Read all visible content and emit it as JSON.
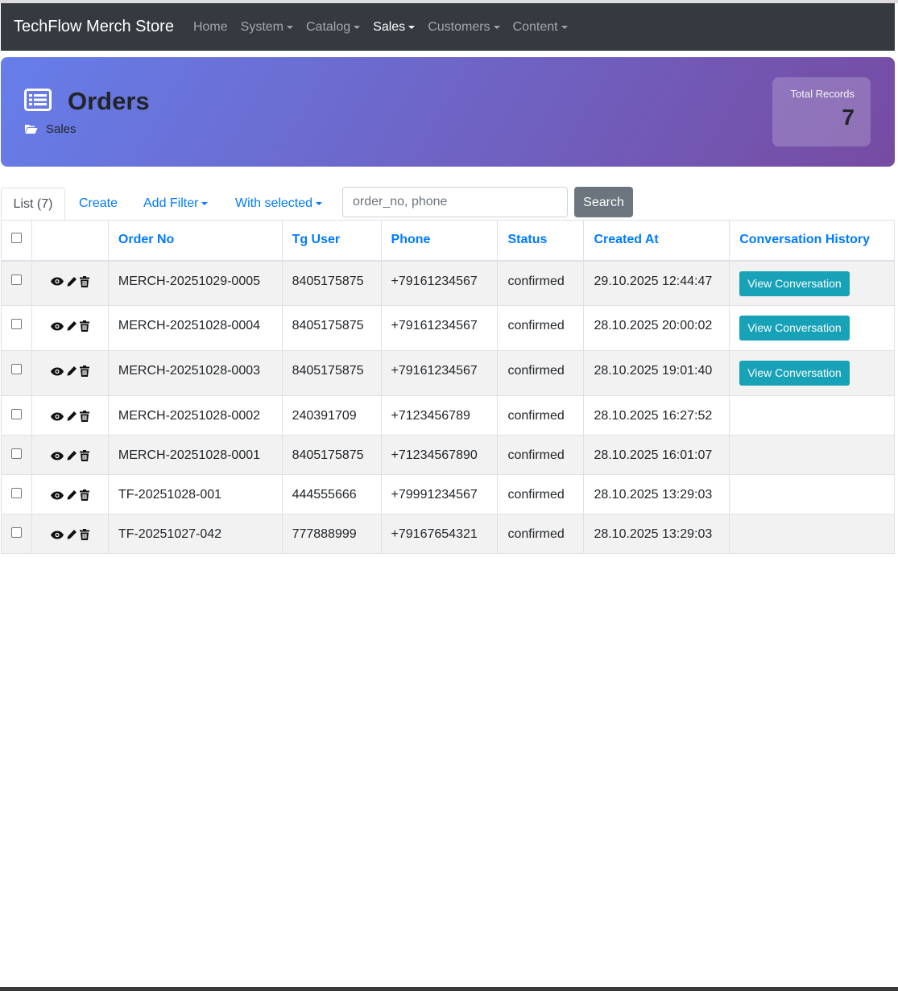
{
  "navbar": {
    "brand": "TechFlow Merch Store",
    "items": [
      {
        "label": "Home",
        "dropdown": false,
        "active": false
      },
      {
        "label": "System",
        "dropdown": true,
        "active": false
      },
      {
        "label": "Catalog",
        "dropdown": true,
        "active": false
      },
      {
        "label": "Sales",
        "dropdown": true,
        "active": true
      },
      {
        "label": "Customers",
        "dropdown": true,
        "active": false
      },
      {
        "label": "Content",
        "dropdown": true,
        "active": false
      }
    ]
  },
  "header": {
    "title": "Orders",
    "breadcrumb": "Sales",
    "total_records_label": "Total Records",
    "total_records_value": "7",
    "gradient_start": "#667eea",
    "gradient_end": "#764ba2"
  },
  "toolbar": {
    "list_tab": "List (7)",
    "create": "Create",
    "add_filter": "Add Filter",
    "with_selected": "With selected",
    "search_placeholder": "order_no, phone",
    "search_button": "Search"
  },
  "table": {
    "columns": [
      "Order No",
      "Tg User",
      "Phone",
      "Status",
      "Created At",
      "Conversation History"
    ],
    "view_conversation_label": "View Conversation",
    "rows": [
      {
        "order_no": "MERCH-20251029-0005",
        "tg_user": "8405175875",
        "phone": "+79161234567",
        "status": "confirmed",
        "created_at": "29.10.2025 12:44:47",
        "has_conversation": true
      },
      {
        "order_no": "MERCH-20251028-0004",
        "tg_user": "8405175875",
        "phone": "+79161234567",
        "status": "confirmed",
        "created_at": "28.10.2025 20:00:02",
        "has_conversation": true
      },
      {
        "order_no": "MERCH-20251028-0003",
        "tg_user": "8405175875",
        "phone": "+79161234567",
        "status": "confirmed",
        "created_at": "28.10.2025 19:01:40",
        "has_conversation": true
      },
      {
        "order_no": "MERCH-20251028-0002",
        "tg_user": "240391709",
        "phone": "+7123456789",
        "status": "confirmed",
        "created_at": "28.10.2025 16:27:52",
        "has_conversation": false
      },
      {
        "order_no": "MERCH-20251028-0001",
        "tg_user": "8405175875",
        "phone": "+71234567890",
        "status": "confirmed",
        "created_at": "28.10.2025 16:01:07",
        "has_conversation": false
      },
      {
        "order_no": "TF-20251028-001",
        "tg_user": "444555666",
        "phone": "+79991234567",
        "status": "confirmed",
        "created_at": "28.10.2025 13:29:03",
        "has_conversation": false
      },
      {
        "order_no": "TF-20251027-042",
        "tg_user": "777888999",
        "phone": "+79167654321",
        "status": "confirmed",
        "created_at": "28.10.2025 13:29:03",
        "has_conversation": false
      }
    ]
  },
  "colors": {
    "navbar_bg": "#343a40",
    "link": "#007bff",
    "info_button": "#17a2b8",
    "secondary_button": "#6c757d"
  },
  "icons": {
    "header": "list-icon",
    "breadcrumb": "folder-open-icon",
    "row_actions": [
      "eye-icon",
      "pencil-icon",
      "trash-icon"
    ]
  }
}
